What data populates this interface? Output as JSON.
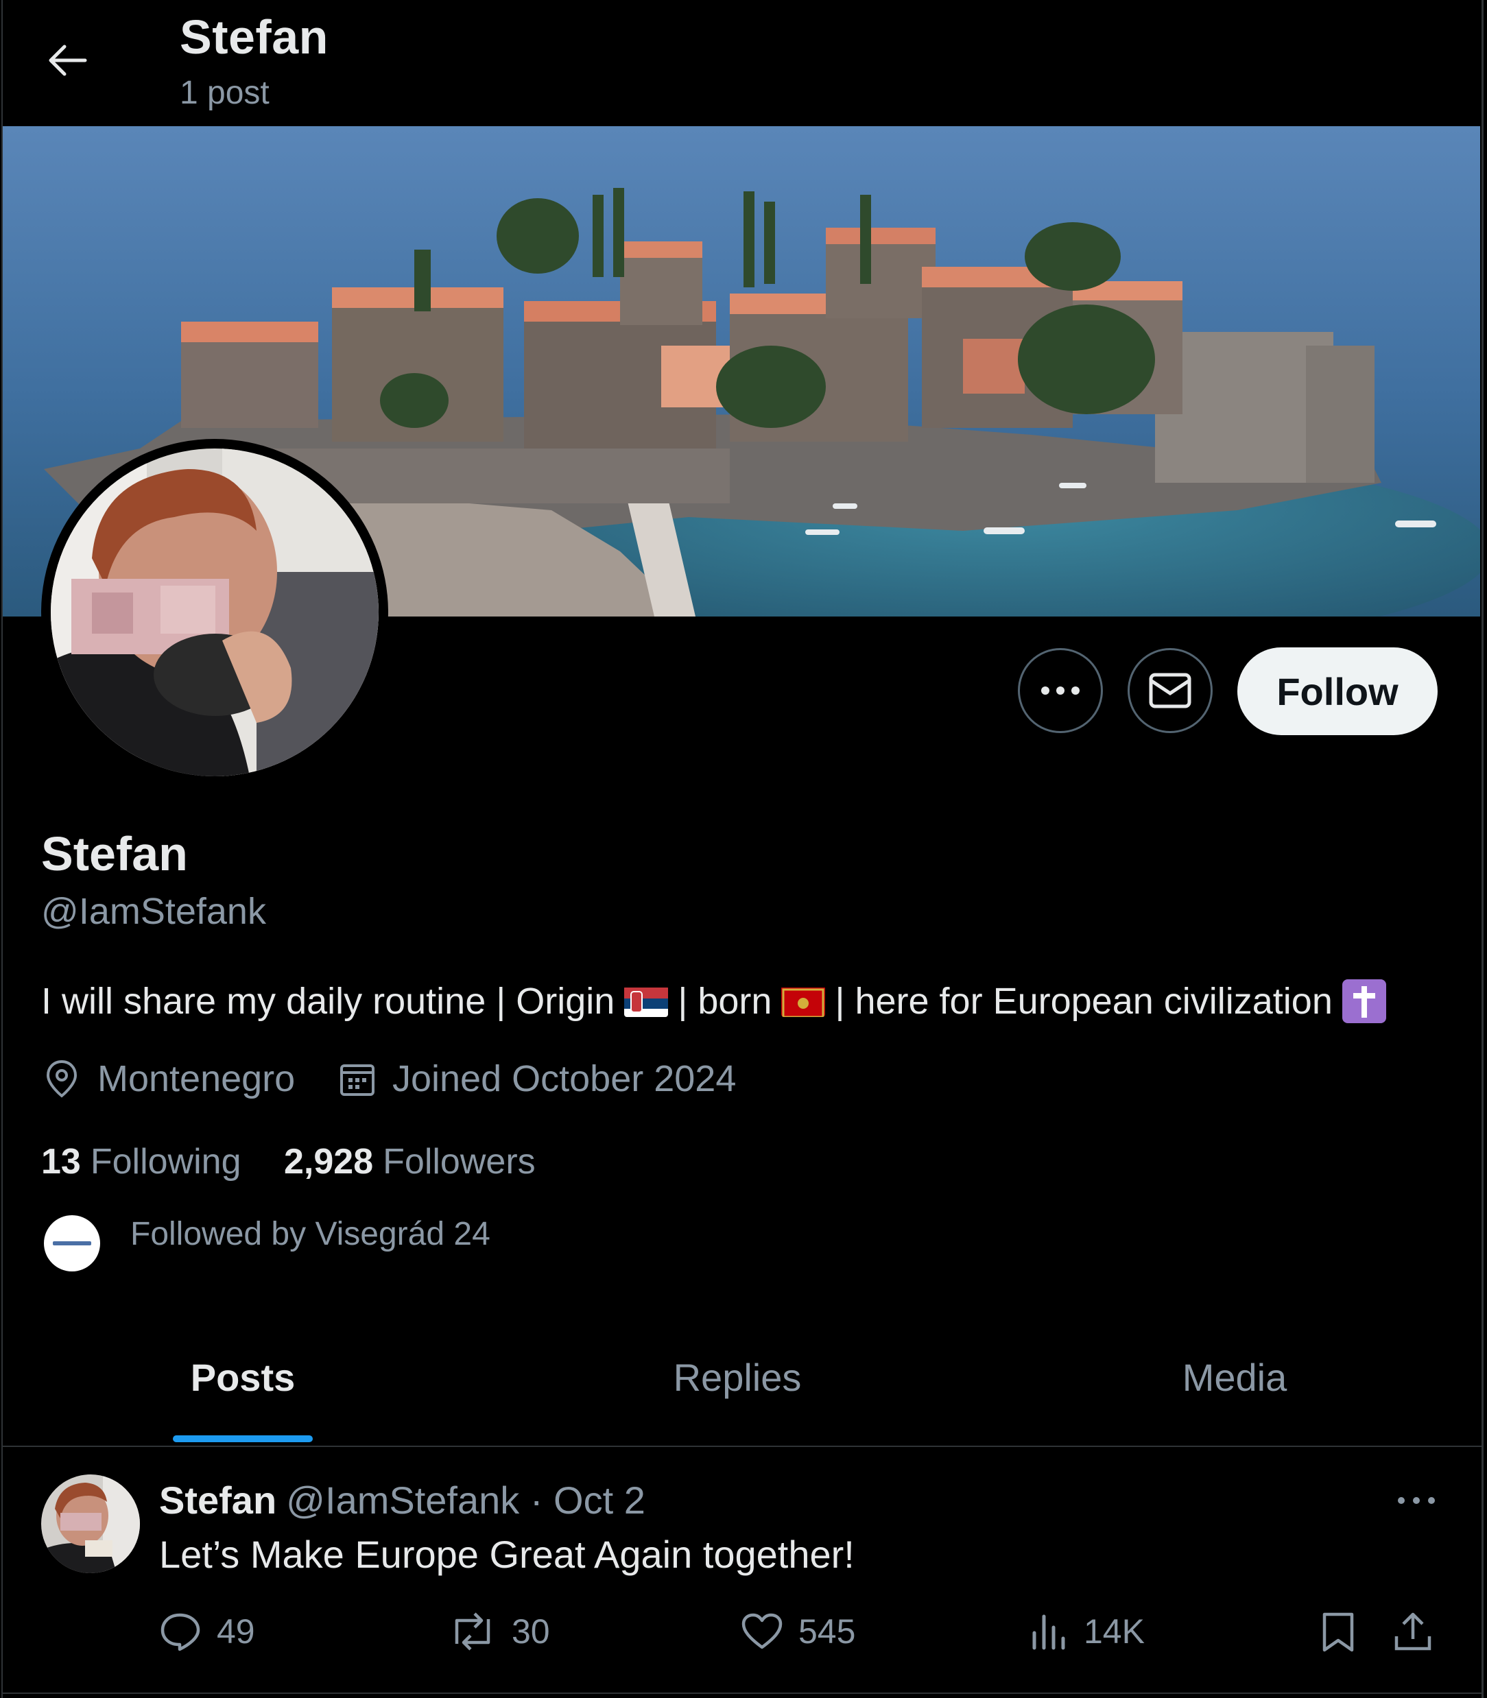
{
  "header": {
    "title": "Stefan",
    "subtitle": "1 post"
  },
  "profile": {
    "name": "Stefan",
    "handle": "@IamStefank",
    "bio": {
      "part1": "I will share my daily routine | Origin",
      "part2": "| born",
      "part3": "| here for European civilization"
    },
    "location": "Montenegro",
    "joined": "Joined October 2024",
    "following_count": "13",
    "following_label": "Following",
    "followers_count": "2,928",
    "followers_label": "Followers",
    "followed_by": "Followed by Visegrád 24"
  },
  "actions": {
    "follow_label": "Follow"
  },
  "tabs": [
    {
      "label": "Posts",
      "active": true
    },
    {
      "label": "Replies",
      "active": false
    },
    {
      "label": "Media",
      "active": false
    }
  ],
  "post": {
    "name": "Stefan",
    "handle_date": "@IamStefank · Oct 2",
    "text": "Let’s Make Europe Great Again together!",
    "replies": "49",
    "reposts": "30",
    "likes": "545",
    "views": "14K"
  },
  "colors": {
    "background": "#000000",
    "text_primary": "#e7e9ea",
    "text_secondary": "#8b98a5",
    "accent": "#1d9bf0",
    "follow_button": "#eff3f4"
  },
  "icons": [
    "back-arrow-icon",
    "more-icon",
    "mail-icon",
    "location-icon",
    "calendar-icon",
    "reply-icon",
    "repost-icon",
    "like-icon",
    "views-icon",
    "bookmark-icon",
    "share-icon"
  ]
}
